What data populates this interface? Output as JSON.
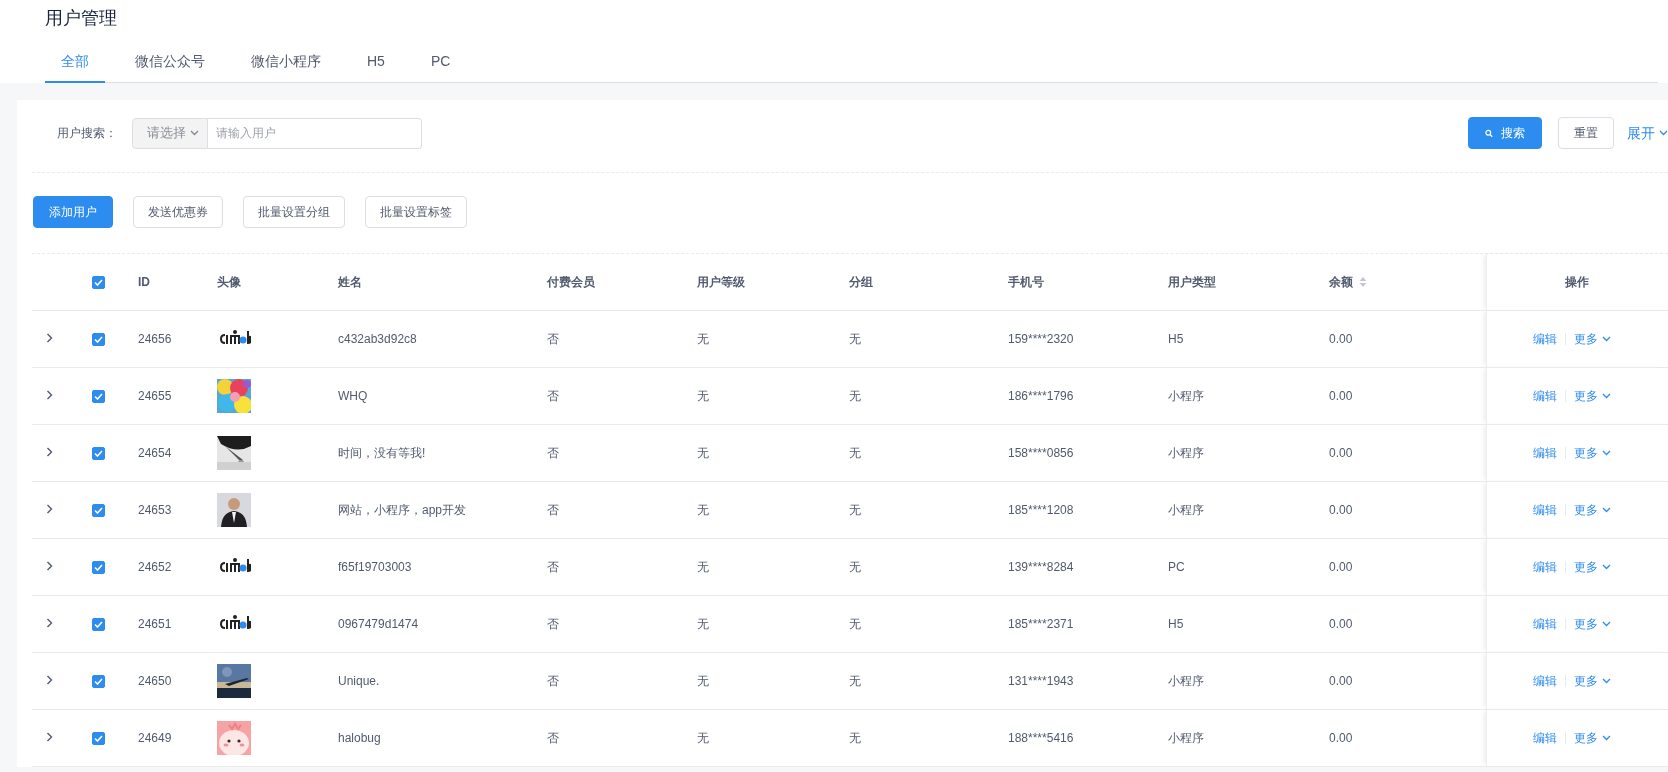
{
  "page_title": "用户管理",
  "tabs": [
    {
      "label": "全部",
      "selected": true
    },
    {
      "label": "微信公众号",
      "selected": false
    },
    {
      "label": "微信小程序",
      "selected": false
    },
    {
      "label": "H5",
      "selected": false
    },
    {
      "label": "PC",
      "selected": false
    }
  ],
  "search": {
    "label": "用户搜索：",
    "select_placeholder": "请选择",
    "placeholder": "请输入用户",
    "search_button": "搜索",
    "reset_button": "重置",
    "expand_link": "展开"
  },
  "toolbar_buttons": [
    {
      "label": "添加用户",
      "kind": "primary"
    },
    {
      "label": "发送优惠券",
      "kind": "default"
    },
    {
      "label": "批量设置分组",
      "kind": "default"
    },
    {
      "label": "批量设置标签",
      "kind": "default"
    }
  ],
  "table": {
    "select_all_checked": true,
    "columns": [
      {
        "label": "ID",
        "sortable": false
      },
      {
        "label": "头像",
        "sortable": false
      },
      {
        "label": "姓名",
        "sortable": false
      },
      {
        "label": "付费会员",
        "sortable": false
      },
      {
        "label": "用户等级",
        "sortable": false
      },
      {
        "label": "分组",
        "sortable": false
      },
      {
        "label": "手机号",
        "sortable": false
      },
      {
        "label": "用户类型",
        "sortable": false
      },
      {
        "label": "余额",
        "sortable": true
      },
      {
        "label": "操作",
        "sortable": false
      }
    ],
    "rows": [
      {
        "expanded": false,
        "checked": true,
        "id": "24656",
        "avatar": {
          "kind": "logo"
        },
        "name": "c432ab3d92c8",
        "paid_member": "否",
        "level": "无",
        "group": "无",
        "phone": "159****2320",
        "user_type": "H5",
        "balance": "0.00",
        "actions": [
          "编辑",
          "更多"
        ]
      },
      {
        "expanded": false,
        "checked": true,
        "id": "24655",
        "avatar": {
          "kind": "flowers"
        },
        "name": "WHQ",
        "paid_member": "否",
        "level": "无",
        "group": "无",
        "phone": "186****1796",
        "user_type": "小程序",
        "balance": "0.00",
        "actions": [
          "编辑",
          "更多"
        ]
      },
      {
        "expanded": false,
        "checked": true,
        "id": "24654",
        "avatar": {
          "kind": "gray"
        },
        "name": "时间，没有等我!",
        "paid_member": "否",
        "level": "无",
        "group": "无",
        "phone": "158****0856",
        "user_type": "小程序",
        "balance": "0.00",
        "actions": [
          "编辑",
          "更多"
        ]
      },
      {
        "expanded": false,
        "checked": true,
        "id": "24653",
        "avatar": {
          "kind": "person"
        },
        "name": "网站，小程序，app开发",
        "paid_member": "否",
        "level": "无",
        "group": "无",
        "phone": "185****1208",
        "user_type": "小程序",
        "balance": "0.00",
        "actions": [
          "编辑",
          "更多"
        ]
      },
      {
        "expanded": false,
        "checked": true,
        "id": "24652",
        "avatar": {
          "kind": "logo"
        },
        "name": "f65f19703003",
        "paid_member": "否",
        "level": "无",
        "group": "无",
        "phone": "139****8284",
        "user_type": "PC",
        "balance": "0.00",
        "actions": [
          "编辑",
          "更多"
        ]
      },
      {
        "expanded": false,
        "checked": true,
        "id": "24651",
        "avatar": {
          "kind": "logo"
        },
        "name": "0967479d1474",
        "paid_member": "否",
        "level": "无",
        "group": "无",
        "phone": "185****2371",
        "user_type": "H5",
        "balance": "0.00",
        "actions": [
          "编辑",
          "更多"
        ]
      },
      {
        "expanded": false,
        "checked": true,
        "id": "24650",
        "avatar": {
          "kind": "sky"
        },
        "name": "Unique.",
        "paid_member": "否",
        "level": "无",
        "group": "无",
        "phone": "131****1943",
        "user_type": "小程序",
        "balance": "0.00",
        "actions": [
          "编辑",
          "更多"
        ]
      },
      {
        "expanded": false,
        "checked": true,
        "id": "24649",
        "avatar": {
          "kind": "cartoon"
        },
        "name": "halobug",
        "paid_member": "否",
        "level": "无",
        "group": "无",
        "phone": "188****5416",
        "user_type": "小程序",
        "balance": "0.00",
        "actions": [
          "编辑",
          "更多"
        ]
      }
    ]
  }
}
